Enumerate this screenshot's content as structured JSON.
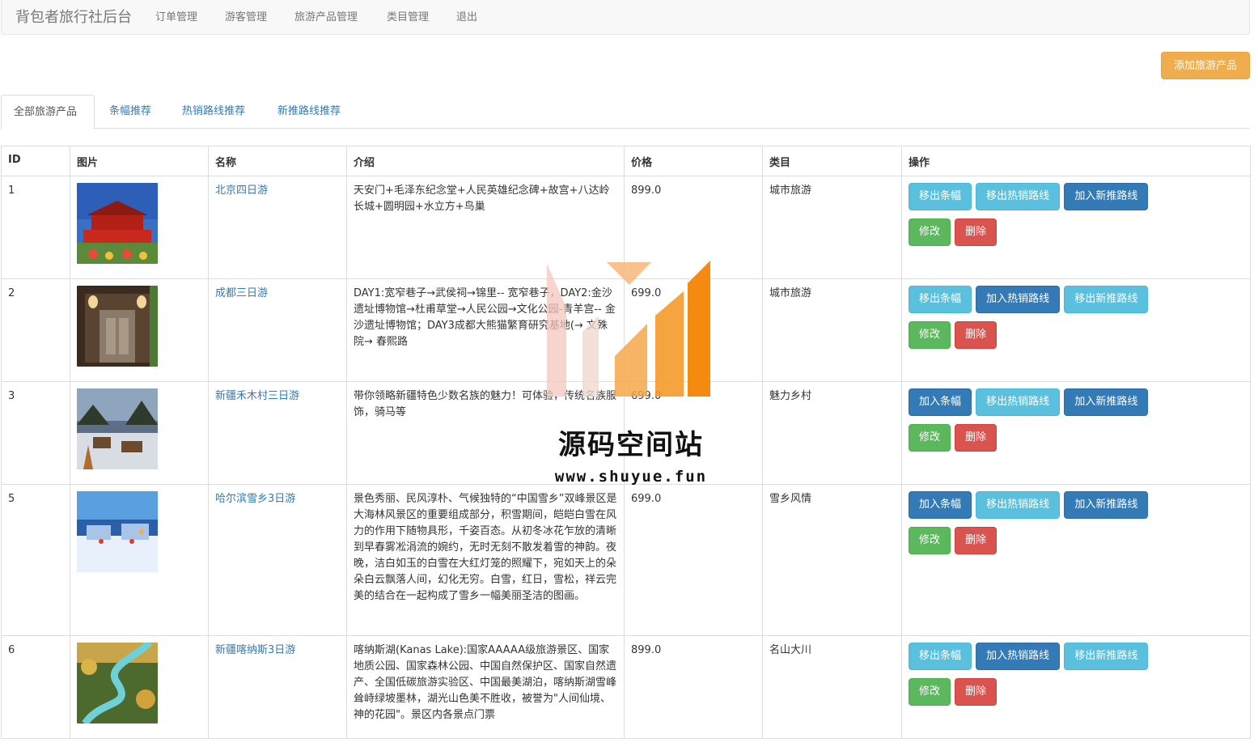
{
  "navbar": {
    "brand": "背包者旅行社后台",
    "items": [
      "订单管理",
      "游客管理",
      "旅游产品管理",
      "类目管理",
      "退出"
    ]
  },
  "add_button": "添加旅游产品",
  "tabs": [
    "全部旅游产品",
    "条幅推荐",
    "热销路线推荐",
    "新推路线推荐"
  ],
  "table": {
    "headers": [
      "ID",
      "图片",
      "名称",
      "介绍",
      "价格",
      "类目",
      "操作"
    ],
    "rows": [
      {
        "id": "1",
        "name": "北京四日游",
        "intro": "天安门+毛泽东纪念堂+人民英雄纪念碑+故宫+八达岭长城+圆明园+水立方+鸟巢",
        "price": "899.0",
        "category": "城市旅游",
        "buttons": [
          {
            "label": "移出条幅",
            "style": "info"
          },
          {
            "label": "移出热销路线",
            "style": "info"
          },
          {
            "label": "加入新推路线",
            "style": "primary"
          }
        ]
      },
      {
        "id": "2",
        "name": "成都三日游",
        "intro": "DAY1:宽窄巷子→武侯祠→锦里-- 宽窄巷子，DAY2:金沙遗址博物馆→杜甫草堂→人民公园→文化公园-青羊宫-- 金沙遗址博物馆；DAY3成都大熊猫繁育研究基地(→ 文殊院→ 春熙路",
        "price": "699.0",
        "category": "城市旅游",
        "buttons": [
          {
            "label": "移出条幅",
            "style": "info"
          },
          {
            "label": "加入热销路线",
            "style": "primary"
          },
          {
            "label": "移出新推路线",
            "style": "info"
          }
        ]
      },
      {
        "id": "3",
        "name": "新疆禾木村三日游",
        "intro": "带你领略新疆特色少数名族的魅力！可体验，传统名族服饰，骑马等",
        "price": "699.0",
        "category": "魅力乡村",
        "buttons": [
          {
            "label": "加入条幅",
            "style": "primary"
          },
          {
            "label": "移出热销路线",
            "style": "info"
          },
          {
            "label": "加入新推路线",
            "style": "primary"
          }
        ]
      },
      {
        "id": "5",
        "name": "哈尔滨雪乡3日游",
        "intro": "景色秀丽、民风淳朴、气候独特的“中国雪乡”双峰景区是大海林风景区的重要组成部分，积雪期间，皑皑白雪在风力的作用下随物具形，千姿百态。从初冬冰花乍放的清晰到早春雾凇涓流的婉约，无时无刻不散发着雪的神韵。夜晚，洁白如玉的白雪在大红灯笼的照耀下，宛如天上的朵朵白云飘落人间，幻化无穷。白雪，红日，雪松，祥云完美的结合在一起构成了雪乡一幅美丽圣洁的图画。",
        "price": "699.0",
        "category": "雪乡风情",
        "buttons": [
          {
            "label": "加入条幅",
            "style": "primary"
          },
          {
            "label": "移出热销路线",
            "style": "info"
          },
          {
            "label": "加入新推路线",
            "style": "primary"
          }
        ]
      },
      {
        "id": "6",
        "name": "新疆喀纳斯3日游",
        "intro": "喀纳斯湖(Kanas Lake):国家AAAAA级旅游景区、国家地质公园、国家森林公园、中国自然保护区、国家自然遗产、全国低碳旅游实验区、中国最美湖泊，喀纳斯湖雪峰耸峙绿坡墨林，湖光山色美不胜收，被誉为\"人间仙境、神的花园\"。景区内各景点门票",
        "price": "899.0",
        "category": "名山大川",
        "buttons": [
          {
            "label": "移出条幅",
            "style": "info"
          },
          {
            "label": "加入热销路线",
            "style": "primary"
          },
          {
            "label": "移出新推路线",
            "style": "info"
          }
        ]
      }
    ],
    "edit_label": "修改",
    "delete_label": "删除"
  },
  "watermark": {
    "title": "源码空间站",
    "url": "www.shuyue.fun"
  },
  "colors": {
    "link": "#337ab7",
    "info": "#5bc0de",
    "primary": "#337ab7",
    "success": "#5cb85c",
    "danger": "#d9534f",
    "warning": "#f0ad4e"
  }
}
